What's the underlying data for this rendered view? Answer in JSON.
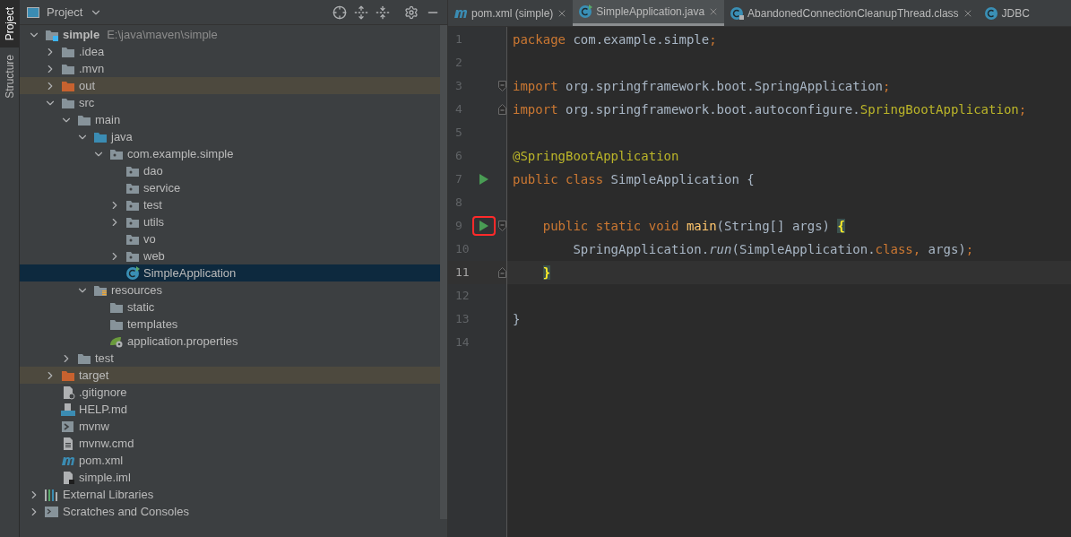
{
  "side_strip": [
    {
      "label": "Project",
      "selected": true
    },
    {
      "label": "Structure",
      "selected": false
    }
  ],
  "project_panel": {
    "title": "Project",
    "tree": [
      {
        "label": "simple",
        "path": "E:\\java\\maven\\simple",
        "kind": "module",
        "expanded": true,
        "selected": false,
        "excluded": false,
        "children": [
          {
            "label": ".idea",
            "kind": "folder",
            "expanded": false,
            "selected": false,
            "excluded": false
          },
          {
            "label": ".mvn",
            "kind": "folder",
            "expanded": false,
            "selected": false,
            "excluded": false
          },
          {
            "label": "out",
            "kind": "excluded-folder",
            "expanded": false,
            "selected": false,
            "excluded": true
          },
          {
            "label": "src",
            "kind": "folder",
            "expanded": true,
            "selected": false,
            "excluded": false,
            "children": [
              {
                "label": "main",
                "kind": "folder",
                "expanded": true,
                "selected": false,
                "excluded": false,
                "children": [
                  {
                    "label": "java",
                    "kind": "source-folder",
                    "expanded": true,
                    "selected": false,
                    "excluded": false,
                    "children": [
                      {
                        "label": "com.example.simple",
                        "kind": "package",
                        "expanded": true,
                        "selected": false,
                        "excluded": false,
                        "children": [
                          {
                            "label": "dao",
                            "kind": "package",
                            "selected": false,
                            "excluded": false
                          },
                          {
                            "label": "service",
                            "kind": "package",
                            "selected": false,
                            "excluded": false
                          },
                          {
                            "label": "test",
                            "kind": "package",
                            "expanded": false,
                            "selected": false,
                            "excluded": false
                          },
                          {
                            "label": "utils",
                            "kind": "package",
                            "expanded": false,
                            "selected": false,
                            "excluded": false
                          },
                          {
                            "label": "vo",
                            "kind": "package",
                            "selected": false,
                            "excluded": false
                          },
                          {
                            "label": "web",
                            "kind": "package",
                            "expanded": false,
                            "selected": false,
                            "excluded": false
                          },
                          {
                            "label": "SimpleApplication",
                            "kind": "spring-class",
                            "selected": true,
                            "excluded": false
                          }
                        ]
                      }
                    ]
                  },
                  {
                    "label": "resources",
                    "kind": "resources-folder",
                    "expanded": true,
                    "selected": false,
                    "excluded": false,
                    "children": [
                      {
                        "label": "static",
                        "kind": "folder",
                        "selected": false,
                        "excluded": false
                      },
                      {
                        "label": "templates",
                        "kind": "folder",
                        "selected": false,
                        "excluded": false
                      },
                      {
                        "label": "application.properties",
                        "kind": "spring-properties",
                        "selected": false,
                        "excluded": false
                      }
                    ]
                  }
                ]
              },
              {
                "label": "test",
                "kind": "folder",
                "expanded": false,
                "selected": false,
                "excluded": false
              }
            ]
          },
          {
            "label": "target",
            "kind": "excluded-folder",
            "expanded": false,
            "selected": false,
            "excluded": true
          },
          {
            "label": ".gitignore",
            "kind": "ignore-file",
            "selected": false,
            "excluded": false
          },
          {
            "label": "HELP.md",
            "kind": "markdown",
            "selected": false,
            "excluded": false
          },
          {
            "label": "mvnw",
            "kind": "script",
            "selected": false,
            "excluded": false
          },
          {
            "label": "mvnw.cmd",
            "kind": "text-file",
            "selected": false,
            "excluded": false
          },
          {
            "label": "pom.xml",
            "kind": "maven",
            "selected": false,
            "excluded": false
          },
          {
            "label": "simple.iml",
            "kind": "iml",
            "selected": false,
            "excluded": false
          }
        ]
      },
      {
        "label": "External Libraries",
        "kind": "libraries",
        "expanded": false,
        "selected": false,
        "excluded": false
      },
      {
        "label": "Scratches and Consoles",
        "kind": "scratches",
        "expanded": false,
        "selected": false,
        "excluded": false
      }
    ]
  },
  "editor_tabs": [
    {
      "label": "pom.xml (simple)",
      "kind": "maven",
      "selected": false,
      "closable": true
    },
    {
      "label": "SimpleApplication.java",
      "kind": "spring-class",
      "selected": true,
      "closable": true
    },
    {
      "label": "AbandonedConnectionCleanupThread.class",
      "kind": "locked-class",
      "selected": false,
      "closable": true
    },
    {
      "label": "JDBC",
      "kind": "class",
      "selected": false,
      "closable": false
    }
  ],
  "code_lines": [
    {
      "number": "1",
      "current": false,
      "tokens": [
        {
          "kind": "keyword",
          "text": "package"
        },
        {
          "kind": "plain",
          "text": " com.example.simple"
        },
        {
          "kind": "keyword",
          "text": ";"
        }
      ]
    },
    {
      "number": "2",
      "current": false
    },
    {
      "number": "3",
      "current": false,
      "markers": [
        {
          "kind": "fold-start"
        }
      ],
      "tokens": [
        {
          "kind": "keyword",
          "text": "import"
        },
        {
          "kind": "plain",
          "text": " org.springframework.boot.SpringApplication"
        },
        {
          "kind": "keyword",
          "text": ";"
        }
      ]
    },
    {
      "number": "4",
      "current": false,
      "markers": [
        {
          "kind": "fold-end"
        }
      ],
      "tokens": [
        {
          "kind": "keyword",
          "text": "import"
        },
        {
          "kind": "plain",
          "text": " org.springframework.boot.autoconfigure."
        },
        {
          "kind": "annotation",
          "text": "SpringBootApplication"
        },
        {
          "kind": "keyword",
          "text": ";"
        }
      ]
    },
    {
      "number": "5",
      "current": false
    },
    {
      "number": "6",
      "current": false,
      "tokens": [
        {
          "kind": "annotation",
          "text": "@SpringBootApplication"
        }
      ]
    },
    {
      "number": "7",
      "current": false,
      "markers": [
        {
          "kind": "run",
          "highlighted": false
        }
      ],
      "tokens": [
        {
          "kind": "keyword",
          "text": "public class"
        },
        {
          "kind": "plain",
          "text": " SimpleApplication {"
        }
      ]
    },
    {
      "number": "8",
      "current": false
    },
    {
      "number": "9",
      "current": false,
      "markers": [
        {
          "kind": "run",
          "highlighted": true
        },
        {
          "kind": "fold-start"
        }
      ],
      "tokens": [
        {
          "kind": "keyword",
          "text": "    public static void "
        },
        {
          "kind": "method",
          "text": "main"
        },
        {
          "kind": "plain",
          "text": "(String[] args) "
        },
        {
          "kind": "brace",
          "text": "{"
        }
      ]
    },
    {
      "number": "10",
      "current": false,
      "tokens": [
        {
          "kind": "plain",
          "text": "        SpringApplication."
        },
        {
          "kind": "static-call",
          "text": "run"
        },
        {
          "kind": "plain",
          "text": "(SimpleApplication."
        },
        {
          "kind": "keyword",
          "text": "class,"
        },
        {
          "kind": "plain",
          "text": " args)"
        },
        {
          "kind": "keyword",
          "text": ";"
        }
      ]
    },
    {
      "number": "11",
      "current": true,
      "markers": [
        {
          "kind": "fold-end"
        }
      ],
      "tokens": [
        {
          "kind": "brace",
          "text": "}",
          "indented": true
        }
      ]
    },
    {
      "number": "12",
      "current": false
    },
    {
      "number": "13",
      "current": false,
      "tokens": [
        {
          "kind": "plain",
          "text": "}"
        }
      ]
    },
    {
      "number": "14",
      "current": false
    }
  ]
}
